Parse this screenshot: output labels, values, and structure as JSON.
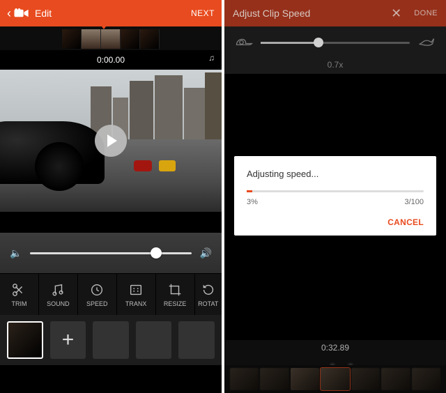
{
  "left": {
    "title": "Edit",
    "next": "NEXT",
    "timecode": "0:00.00",
    "volume_percent": 78,
    "tools": [
      {
        "id": "trim",
        "label": "TRIM"
      },
      {
        "id": "sound",
        "label": "SOUND"
      },
      {
        "id": "speed",
        "label": "SPEED"
      },
      {
        "id": "tranx",
        "label": "TRANX"
      },
      {
        "id": "resize",
        "label": "RESIZE"
      },
      {
        "id": "rotate",
        "label": "ROTAT"
      }
    ]
  },
  "right": {
    "title": "Adjust Clip Speed",
    "done": "DONE",
    "speed_value_label": "0.7x",
    "speed_slider_percent": 39,
    "timecode": "0:32.89",
    "dialog": {
      "title": "Adjusting speed...",
      "percent_label": "3%",
      "count_label": "3/100",
      "cancel": "CANCEL",
      "progress_percent": 3
    }
  },
  "colors": {
    "accent": "#e84b1f"
  }
}
